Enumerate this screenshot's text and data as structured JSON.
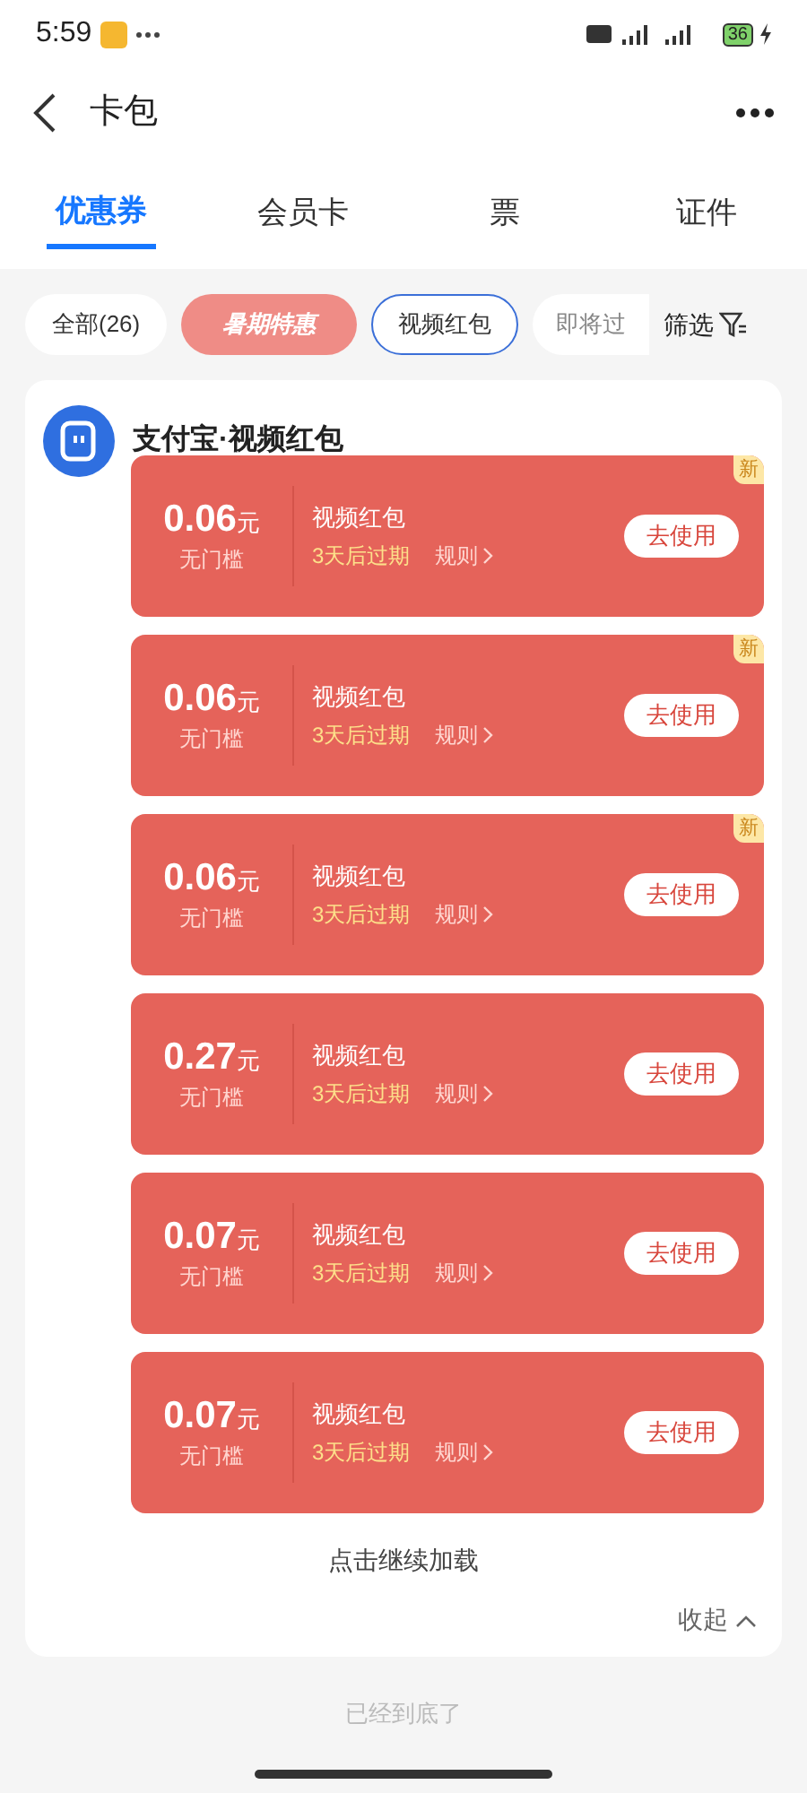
{
  "status_bar": {
    "time": "5:59",
    "battery": "36"
  },
  "header": {
    "title": "卡包"
  },
  "tabs": [
    {
      "label": "优惠券",
      "selected": true
    },
    {
      "label": "会员卡",
      "selected": false
    },
    {
      "label": "票",
      "selected": false
    },
    {
      "label": "证件",
      "selected": false
    }
  ],
  "filters": [
    {
      "label": "全部(26)",
      "kind": "plain",
      "selected": false
    },
    {
      "label": "暑期特惠",
      "kind": "promo",
      "selected": false
    },
    {
      "label": "视频红包",
      "kind": "plain",
      "selected": true
    },
    {
      "label": "即将过",
      "kind": "faded",
      "selected": false
    }
  ],
  "filter_button": "筛选",
  "group": {
    "title": "支付宝·视频红包",
    "coupons": [
      {
        "amount": "0.06",
        "unit": "元",
        "condition": "无门槛",
        "title": "视频红包",
        "expiry": "3天后过期",
        "rules": "规则",
        "action": "去使用",
        "badge": "新"
      },
      {
        "amount": "0.06",
        "unit": "元",
        "condition": "无门槛",
        "title": "视频红包",
        "expiry": "3天后过期",
        "rules": "规则",
        "action": "去使用",
        "badge": "新"
      },
      {
        "amount": "0.06",
        "unit": "元",
        "condition": "无门槛",
        "title": "视频红包",
        "expiry": "3天后过期",
        "rules": "规则",
        "action": "去使用",
        "badge": "新"
      },
      {
        "amount": "0.27",
        "unit": "元",
        "condition": "无门槛",
        "title": "视频红包",
        "expiry": "3天后过期",
        "rules": "规则",
        "action": "去使用"
      },
      {
        "amount": "0.07",
        "unit": "元",
        "condition": "无门槛",
        "title": "视频红包",
        "expiry": "3天后过期",
        "rules": "规则",
        "action": "去使用"
      },
      {
        "amount": "0.07",
        "unit": "元",
        "condition": "无门槛",
        "title": "视频红包",
        "expiry": "3天后过期",
        "rules": "规则",
        "action": "去使用"
      }
    ],
    "load_more": "点击继续加载",
    "collapse": "收起"
  },
  "footer_hint": "已经到底了"
}
